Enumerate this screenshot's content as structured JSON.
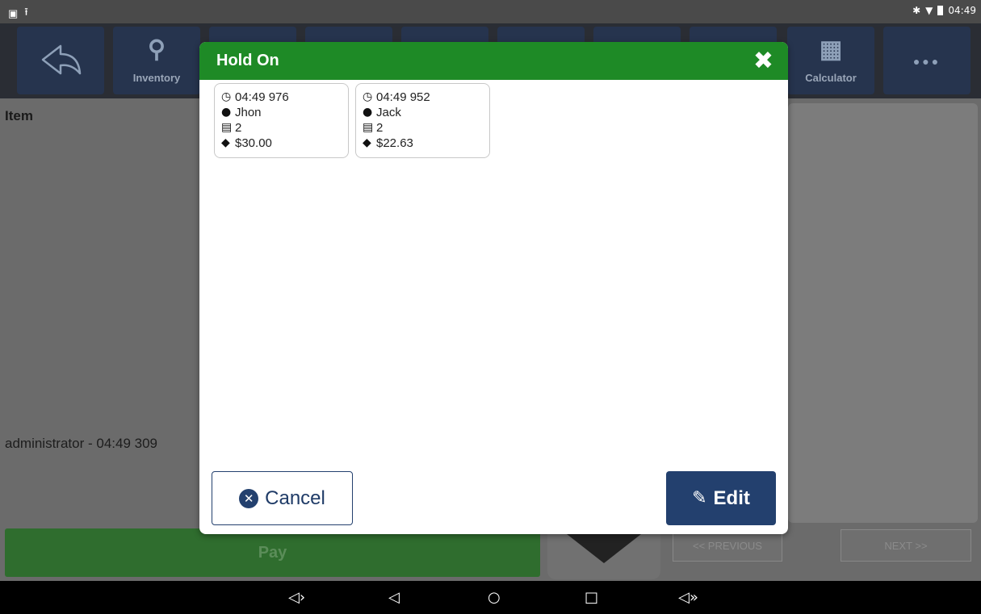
{
  "status_bar": {
    "time": "04:49"
  },
  "toolbar": {
    "inventory_label": "Inventory",
    "calculator_label": "Calculator",
    "more_label": "●●●"
  },
  "background": {
    "item_header": "Item",
    "admin_line": "administrator - 04:49 309",
    "pay_label": "Pay",
    "prev_label": "<< PREVIOUS",
    "next_label": "NEXT >>"
  },
  "modal": {
    "title": "Hold On",
    "close_glyph": "✖",
    "cards": [
      {
        "time": "04:49 976",
        "customer": "Jhon",
        "items": "2",
        "total": "$30.00"
      },
      {
        "time": "04:49 952",
        "customer": "Jack",
        "items": "2",
        "total": "$22.63"
      }
    ],
    "cancel_label": "Cancel",
    "edit_label": "Edit"
  },
  "colors": {
    "header_green": "#1e8a26",
    "button_navy": "#23406e",
    "pay_green": "#2f6d2e"
  }
}
